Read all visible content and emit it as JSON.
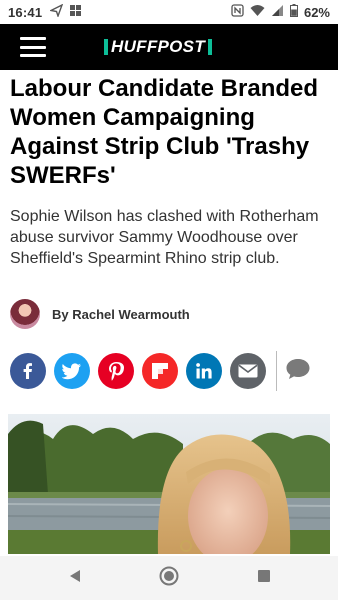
{
  "status_bar": {
    "time": "16:41",
    "battery": "62%",
    "icons": [
      "send-icon",
      "gallery-icon",
      "nfc-icon",
      "wifi-icon",
      "signal-icon",
      "battery-icon"
    ]
  },
  "header": {
    "logo": "HUFFPOST",
    "menu_icon": "hamburger-menu-icon",
    "accent_color": "#0dbe98"
  },
  "article": {
    "headline": "Labour Candidate Branded Women Campaigning Against Strip Club 'Trashy SWERFs'",
    "dek": "Sophie Wilson has clashed with Rotherham abuse survivor Sammy Woodhouse over Sheffield's Spearmint Rhino strip club.",
    "byline": "By Rachel Wearmouth"
  },
  "share": {
    "buttons": [
      {
        "name": "facebook",
        "icon": "facebook-icon",
        "color": "#3b5998"
      },
      {
        "name": "twitter",
        "icon": "twitter-icon",
        "color": "#1da1f2"
      },
      {
        "name": "pinterest",
        "icon": "pinterest-icon",
        "color": "#e60023"
      },
      {
        "name": "flipboard",
        "icon": "flipboard-icon",
        "color": "#f52828"
      },
      {
        "name": "linkedin",
        "icon": "linkedin-icon",
        "color": "#0077b5"
      },
      {
        "name": "email",
        "icon": "email-icon",
        "color": "#5f6368"
      }
    ],
    "comment_icon": "comment-icon"
  },
  "nav_bar": {
    "buttons": [
      "back-icon",
      "home-icon",
      "recents-icon"
    ]
  }
}
